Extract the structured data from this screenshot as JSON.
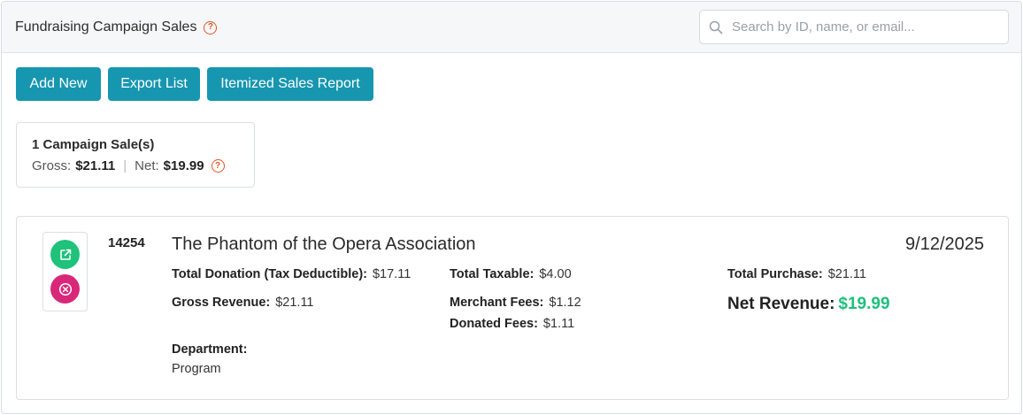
{
  "header": {
    "title": "Fundraising Campaign Sales",
    "help_glyph": "?",
    "search_placeholder": "Search by ID, name, or email..."
  },
  "toolbar": {
    "add_label": "Add New",
    "export_label": "Export List",
    "report_label": "Itemized Sales Report"
  },
  "summary": {
    "count_text": "1 Campaign Sale(s)",
    "gross_label": "Gross:",
    "gross_value": "$21.11",
    "separator": "|",
    "net_label": "Net:",
    "net_value": "$19.99"
  },
  "sale": {
    "id": "14254",
    "name": "The Phantom of the Opera Association",
    "date": "9/12/2025",
    "total_donation_label": "Total Donation (Tax Deductible):",
    "total_donation_value": "$17.11",
    "gross_revenue_label": "Gross Revenue:",
    "gross_revenue_value": "$21.11",
    "total_taxable_label": "Total Taxable:",
    "total_taxable_value": "$4.00",
    "merchant_fees_label": "Merchant Fees:",
    "merchant_fees_value": "$1.12",
    "donated_fees_label": "Donated Fees:",
    "donated_fees_value": "$1.11",
    "total_purchase_label": "Total Purchase:",
    "total_purchase_value": "$21.11",
    "net_revenue_label": "Net Revenue:",
    "net_revenue_value": "$19.99",
    "department_label": "Department:",
    "department_value": "Program"
  },
  "icons": {
    "help": "question-circle-icon",
    "search": "magnifier-icon",
    "open": "external-link-icon",
    "delete": "close-circle-icon"
  },
  "colors": {
    "button": "#1796b0",
    "help": "#e0562a",
    "open_action": "#1ec27a",
    "delete_action": "#d8287a",
    "net_revenue": "#1fbf7c"
  }
}
